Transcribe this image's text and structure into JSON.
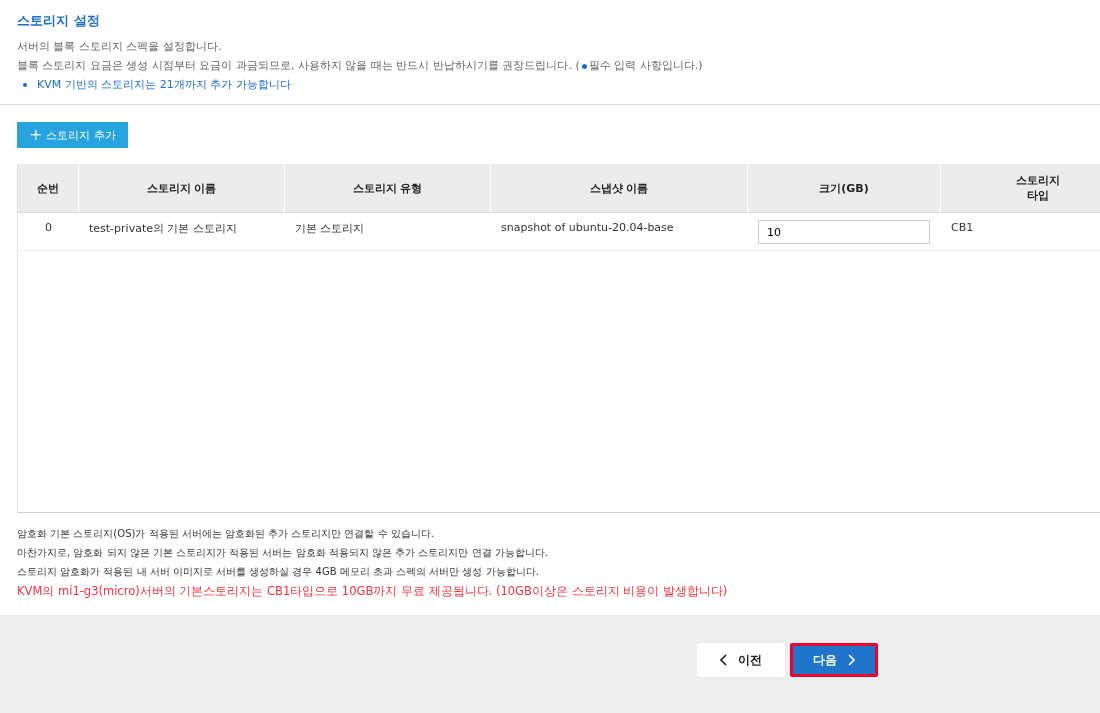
{
  "section": {
    "title": "스토리지 설정",
    "description": "서버의 블록 스토리지 스펙을 설정합니다.",
    "notice_before": "블록 스토리지 요금은 생성 시점부터 요금이 과금되므로, 사용하지 않을 때는 반드시 반납하시기를 권장드립니다. (",
    "notice_after": "필수 입력 사항입니다.)",
    "bullets": [
      "KVM 기반의 스토리지는 21개까지 추가 가능합니다"
    ]
  },
  "add_button": {
    "icon": "+",
    "label": "스토리지 추가"
  },
  "table": {
    "columns": [
      "순번",
      "스토리지 이름",
      "스토리지 유형",
      "스냅샷 이름",
      "크기(GB)",
      "스토리지\n타입"
    ],
    "rows": [
      {
        "index": "0",
        "name": "test-private의 기본 스토리지",
        "type": "기본 스토리지",
        "snapshot": "snapshot of ubuntu-20.04-base",
        "size": "10",
        "storage_type": "CB1"
      }
    ]
  },
  "notes": [
    {
      "text": "암호화 기본 스토리지(OS)가 적용된 서버에는 암호화된 추가 스토리지만 연결할 수 있습니다.",
      "kind": "normal"
    },
    {
      "text": "마찬가지로, 암호화 되지 않은 기본 스토리지가 적용된 서버는 암호화 적용되지 않은 추가 스토리지만 연결 가능합니다.",
      "kind": "normal"
    },
    {
      "text": "스토리지 암호화가 적용된 내 서버 이미지로 서버를 생성하실 경우 4GB 메모리 초과 스펙의 서버만 생성 가능합니다.",
      "kind": "normal"
    },
    {
      "text": "KVM의 mi1-g3(micro)서버의 기본스토리지는 CB1타입으로 10GB까지 무료 제공됩니다. (10GB이상은 스토리지 비용이 발생합니다)",
      "kind": "warning"
    }
  ],
  "footer": {
    "prev": {
      "label": "이전",
      "highlighted": false
    },
    "next": {
      "label": "다음",
      "highlighted": true
    }
  }
}
